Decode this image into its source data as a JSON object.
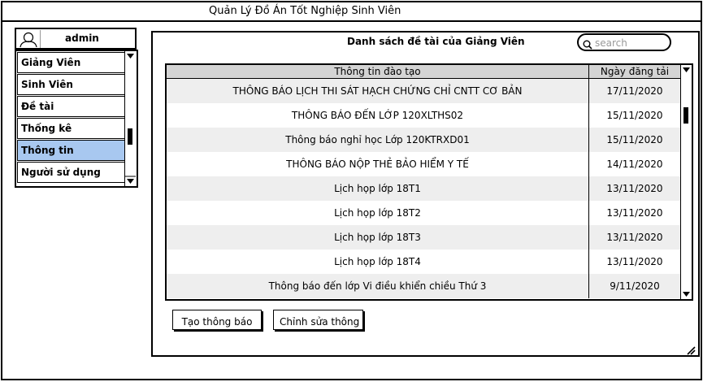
{
  "window": {
    "title": "Quản Lý Đồ Án Tốt Nghiệp Sinh Viên"
  },
  "user": {
    "name": "admin",
    "icon": "user-icon"
  },
  "sidebar": {
    "items": [
      {
        "label": "Giảng Viên",
        "active": false
      },
      {
        "label": "Sinh Viên",
        "active": false
      },
      {
        "label": "Đề tài",
        "active": false
      },
      {
        "label": "Thống kê",
        "active": false
      },
      {
        "label": "Thông tin",
        "active": true
      },
      {
        "label": "Người sử dụng",
        "active": false
      }
    ]
  },
  "main": {
    "title": "Danh sách đề tài của Giảng Viên",
    "search": {
      "placeholder": "search",
      "value": "",
      "icon": "search-icon"
    },
    "table": {
      "columns": [
        "Thông tin đào tạo",
        "Ngày đăng tải"
      ],
      "rows": [
        [
          "THÔNG BÁO LỊCH THI SÁT HẠCH CHỨNG CHỈ CNTT CƠ BẢN",
          "17/11/2020"
        ],
        [
          "THÔNG BÁO ĐẾN LỚP 120XLTHS02",
          "15/11/2020"
        ],
        [
          "Thông báo nghỉ học Lớp 120KTRXD01",
          "15/11/2020"
        ],
        [
          "THÔNG BÁO NỘP THẺ BẢO HIỂM Y TẾ",
          "14/11/2020"
        ],
        [
          "Lịch họp lớp 18T1",
          "13/11/2020"
        ],
        [
          "Lịch họp lớp 18T2",
          "13/11/2020"
        ],
        [
          "Lịch họp lớp 18T3",
          "13/11/2020"
        ],
        [
          "Lịch họp lớp 18T4",
          "13/11/2020"
        ],
        [
          "Thông báo đến lớp Vi điều khiển chiều Thứ 3",
          "9/11/2020"
        ]
      ]
    },
    "buttons": {
      "create": "Tạo thông báo",
      "edit": "Chỉnh sửa thông"
    }
  },
  "colors": {
    "active_item": "#a8c8f0",
    "header_bg": "#d4d4d4",
    "row_alt": "#eeeeee"
  }
}
